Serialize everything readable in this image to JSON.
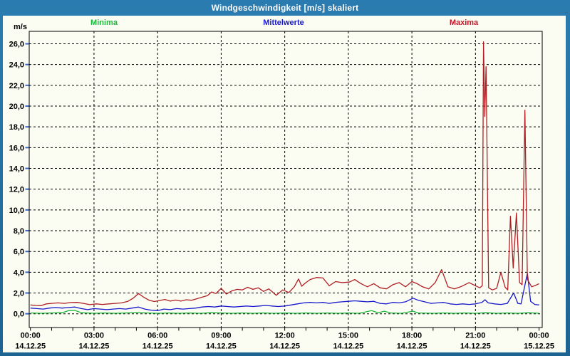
{
  "window": {
    "title": "Windgeschwindigkeit [m/s] skaliert"
  },
  "legend": {
    "items": [
      {
        "label": "Minima",
        "color": "#1CB83C",
        "x": 146
      },
      {
        "label": "Mittelwerte",
        "color": "#1818CC",
        "x": 398
      },
      {
        "label": "Maxima",
        "color": "#C01828",
        "x": 651
      }
    ]
  },
  "colors": {
    "frame": "#1F6FA6",
    "background": "#FBFDF3",
    "grid": "#000000",
    "axis": "#000000",
    "y_tick": "#3A66C8",
    "title_text": "#FFFFFF"
  },
  "chart_data": {
    "type": "line",
    "title": "Windgeschwindigkeit [m/s] skaliert",
    "ylabel": "m/s",
    "xlabel": "",
    "ylim": [
      0,
      26
    ],
    "y_tick_step": 2,
    "y_tick_labels": [
      "0,0",
      "2,0",
      "4,0",
      "6,0",
      "8,0",
      "10,0",
      "12,0",
      "14,0",
      "16,0",
      "18,0",
      "20,0",
      "22,0",
      "24,0",
      "26,0"
    ],
    "grid": "dashed",
    "legend_position": "top",
    "x_minor_tick_every_hours": 1,
    "x_major_ticks": [
      {
        "hour": 0,
        "time": "00:00",
        "date": "14.12.25"
      },
      {
        "hour": 3,
        "time": "03:00",
        "date": "14.12.25"
      },
      {
        "hour": 6,
        "time": "06:00",
        "date": "14.12.25"
      },
      {
        "hour": 9,
        "time": "09:00",
        "date": "14.12.25"
      },
      {
        "hour": 12,
        "time": "12:00",
        "date": "14.12.25"
      },
      {
        "hour": 15,
        "time": "15:00",
        "date": "14.12.25"
      },
      {
        "hour": 18,
        "time": "18:00",
        "date": "14.12.25"
      },
      {
        "hour": 21,
        "time": "21:00",
        "date": "14.12.25"
      },
      {
        "hour": 24,
        "time": "00:00",
        "date": "15.12.25"
      }
    ],
    "series": [
      {
        "name": "Minima",
        "color": "#1CB83C",
        "points": [
          [
            0,
            0.08
          ],
          [
            0.5,
            0.05
          ],
          [
            1.0,
            0.08
          ],
          [
            1.5,
            0.1
          ],
          [
            1.8,
            0.3
          ],
          [
            2.1,
            0.32
          ],
          [
            2.4,
            0.1
          ],
          [
            3.0,
            0.05
          ],
          [
            3.5,
            0.08
          ],
          [
            4.0,
            0.05
          ],
          [
            4.5,
            0.08
          ],
          [
            5.0,
            0.12
          ],
          [
            5.5,
            0.08
          ],
          [
            6.0,
            0.05
          ],
          [
            6.5,
            0.08
          ],
          [
            7.0,
            0.05
          ],
          [
            7.5,
            0.08
          ],
          [
            8.0,
            0.05
          ],
          [
            8.5,
            0.1
          ],
          [
            9.0,
            0.08
          ],
          [
            9.5,
            0.05
          ],
          [
            10.0,
            0.08
          ],
          [
            10.5,
            0.05
          ],
          [
            11.0,
            0.08
          ],
          [
            11.5,
            0.05
          ],
          [
            12.0,
            0.08
          ],
          [
            12.5,
            0.05
          ],
          [
            13.0,
            0.08
          ],
          [
            13.5,
            0.05
          ],
          [
            14.0,
            0.08
          ],
          [
            14.5,
            0.05
          ],
          [
            15.0,
            0.08
          ],
          [
            15.5,
            0.05
          ],
          [
            16.1,
            0.3
          ],
          [
            16.4,
            0.1
          ],
          [
            16.7,
            0.25
          ],
          [
            17.0,
            0.08
          ],
          [
            17.5,
            0.05
          ],
          [
            18.05,
            0.25
          ],
          [
            18.3,
            0.08
          ],
          [
            19.0,
            0.05
          ],
          [
            19.5,
            0.08
          ],
          [
            20.0,
            0.05
          ],
          [
            20.5,
            0.08
          ],
          [
            21.0,
            0.05
          ],
          [
            21.5,
            0.1
          ],
          [
            22.0,
            0.05
          ],
          [
            22.5,
            0.08
          ],
          [
            23.0,
            0.05
          ],
          [
            23.5,
            0.1
          ],
          [
            24.0,
            0.05
          ]
        ]
      },
      {
        "name": "Mittelwerte",
        "color": "#1818CC",
        "points": [
          [
            0,
            0.55
          ],
          [
            0.3,
            0.5
          ],
          [
            0.6,
            0.45
          ],
          [
            0.9,
            0.55
          ],
          [
            1.2,
            0.6
          ],
          [
            1.5,
            0.55
          ],
          [
            1.8,
            0.6
          ],
          [
            2.1,
            0.65
          ],
          [
            2.4,
            0.5
          ],
          [
            2.7,
            0.4
          ],
          [
            3.0,
            0.5
          ],
          [
            3.3,
            0.45
          ],
          [
            3.6,
            0.4
          ],
          [
            3.9,
            0.45
          ],
          [
            4.2,
            0.5
          ],
          [
            4.5,
            0.45
          ],
          [
            4.8,
            0.55
          ],
          [
            5.1,
            0.65
          ],
          [
            5.4,
            0.45
          ],
          [
            5.7,
            0.35
          ],
          [
            6.0,
            0.3
          ],
          [
            6.3,
            0.45
          ],
          [
            6.6,
            0.4
          ],
          [
            6.9,
            0.5
          ],
          [
            7.2,
            0.45
          ],
          [
            7.5,
            0.5
          ],
          [
            7.8,
            0.55
          ],
          [
            8.1,
            0.65
          ],
          [
            8.4,
            0.7
          ],
          [
            8.7,
            0.65
          ],
          [
            9.0,
            0.75
          ],
          [
            9.3,
            0.7
          ],
          [
            9.6,
            0.65
          ],
          [
            9.9,
            0.7
          ],
          [
            10.2,
            0.75
          ],
          [
            10.5,
            0.7
          ],
          [
            10.8,
            0.75
          ],
          [
            11.1,
            0.8
          ],
          [
            11.4,
            0.75
          ],
          [
            11.7,
            0.7
          ],
          [
            12.0,
            0.75
          ],
          [
            12.3,
            0.85
          ],
          [
            12.6,
            0.95
          ],
          [
            12.9,
            1.05
          ],
          [
            13.2,
            1.1
          ],
          [
            13.5,
            1.05
          ],
          [
            13.8,
            1.1
          ],
          [
            14.1,
            1.0
          ],
          [
            14.4,
            1.1
          ],
          [
            14.7,
            1.15
          ],
          [
            15.0,
            1.2
          ],
          [
            15.3,
            1.25
          ],
          [
            15.6,
            1.2
          ],
          [
            15.9,
            1.15
          ],
          [
            16.2,
            1.2
          ],
          [
            16.5,
            1.0
          ],
          [
            16.8,
            0.95
          ],
          [
            17.1,
            1.1
          ],
          [
            17.4,
            1.05
          ],
          [
            17.7,
            1.15
          ],
          [
            18.05,
            1.5
          ],
          [
            18.3,
            1.3
          ],
          [
            18.6,
            1.15
          ],
          [
            18.9,
            1.0
          ],
          [
            19.2,
            1.05
          ],
          [
            19.5,
            1.1
          ],
          [
            19.8,
            0.95
          ],
          [
            20.1,
            0.9
          ],
          [
            20.4,
            0.95
          ],
          [
            20.7,
            0.9
          ],
          [
            21.0,
            0.95
          ],
          [
            21.3,
            1.1
          ],
          [
            21.45,
            1.35
          ],
          [
            21.6,
            1.05
          ],
          [
            21.9,
            0.95
          ],
          [
            22.2,
            0.9
          ],
          [
            22.5,
            1.0
          ],
          [
            22.8,
            2.0
          ],
          [
            23.0,
            1.0
          ],
          [
            23.15,
            0.95
          ],
          [
            23.45,
            3.9
          ],
          [
            23.6,
            1.2
          ],
          [
            23.8,
            0.9
          ],
          [
            24.0,
            0.85
          ]
        ]
      },
      {
        "name": "Maxima",
        "color": "#B01E24",
        "points": [
          [
            0,
            0.85
          ],
          [
            0.25,
            0.8
          ],
          [
            0.5,
            0.78
          ],
          [
            0.75,
            0.95
          ],
          [
            1.0,
            1.0
          ],
          [
            1.3,
            1.05
          ],
          [
            1.6,
            1.0
          ],
          [
            1.9,
            1.08
          ],
          [
            2.2,
            1.1
          ],
          [
            2.5,
            1.0
          ],
          [
            2.8,
            0.88
          ],
          [
            3.1,
            0.95
          ],
          [
            3.4,
            0.9
          ],
          [
            3.7,
            0.95
          ],
          [
            4.0,
            1.0
          ],
          [
            4.3,
            1.05
          ],
          [
            4.6,
            1.2
          ],
          [
            4.85,
            1.5
          ],
          [
            5.1,
            1.95
          ],
          [
            5.35,
            1.6
          ],
          [
            5.6,
            1.3
          ],
          [
            5.85,
            1.18
          ],
          [
            6.1,
            1.28
          ],
          [
            6.35,
            1.38
          ],
          [
            6.6,
            1.22
          ],
          [
            6.85,
            1.32
          ],
          [
            7.1,
            1.22
          ],
          [
            7.35,
            1.35
          ],
          [
            7.6,
            1.3
          ],
          [
            7.85,
            1.45
          ],
          [
            8.1,
            1.6
          ],
          [
            8.35,
            1.75
          ],
          [
            8.55,
            2.1
          ],
          [
            8.75,
            1.95
          ],
          [
            9.0,
            2.45
          ],
          [
            9.25,
            1.9
          ],
          [
            9.5,
            2.2
          ],
          [
            9.75,
            2.35
          ],
          [
            10.0,
            2.3
          ],
          [
            10.25,
            2.55
          ],
          [
            10.5,
            2.35
          ],
          [
            10.75,
            2.5
          ],
          [
            11.0,
            2.15
          ],
          [
            11.25,
            2.4
          ],
          [
            11.6,
            1.78
          ],
          [
            11.9,
            2.3
          ],
          [
            12.2,
            2.05
          ],
          [
            12.45,
            2.6
          ],
          [
            12.65,
            3.35
          ],
          [
            12.8,
            2.65
          ],
          [
            13.0,
            3.0
          ],
          [
            13.2,
            3.3
          ],
          [
            13.5,
            3.5
          ],
          [
            13.8,
            3.45
          ],
          [
            14.1,
            2.7
          ],
          [
            14.4,
            3.1
          ],
          [
            14.7,
            3.0
          ],
          [
            15.05,
            3.05
          ],
          [
            15.3,
            3.3
          ],
          [
            15.6,
            2.9
          ],
          [
            15.9,
            2.6
          ],
          [
            16.2,
            2.9
          ],
          [
            16.5,
            2.5
          ],
          [
            16.8,
            2.4
          ],
          [
            17.1,
            2.8
          ],
          [
            17.4,
            3.0
          ],
          [
            17.7,
            2.6
          ],
          [
            18.0,
            3.1
          ],
          [
            18.25,
            2.9
          ],
          [
            18.5,
            2.6
          ],
          [
            18.8,
            2.4
          ],
          [
            19.1,
            3.0
          ],
          [
            19.4,
            4.25
          ],
          [
            19.7,
            2.6
          ],
          [
            20.0,
            2.4
          ],
          [
            20.3,
            2.6
          ],
          [
            20.7,
            3.0
          ],
          [
            21.0,
            2.7
          ],
          [
            21.2,
            2.5
          ],
          [
            21.32,
            2.7
          ],
          [
            21.38,
            26.2
          ],
          [
            21.44,
            19.0
          ],
          [
            21.5,
            23.8
          ],
          [
            21.62,
            2.5
          ],
          [
            21.8,
            2.3
          ],
          [
            22.0,
            2.45
          ],
          [
            22.2,
            4.0
          ],
          [
            22.4,
            2.55
          ],
          [
            22.52,
            2.3
          ],
          [
            22.65,
            9.4
          ],
          [
            22.78,
            4.4
          ],
          [
            22.93,
            9.7
          ],
          [
            23.08,
            3.0
          ],
          [
            23.2,
            2.8
          ],
          [
            23.33,
            19.6
          ],
          [
            23.45,
            3.3
          ],
          [
            23.65,
            2.6
          ],
          [
            23.85,
            2.75
          ],
          [
            24.0,
            2.9
          ]
        ]
      }
    ]
  }
}
